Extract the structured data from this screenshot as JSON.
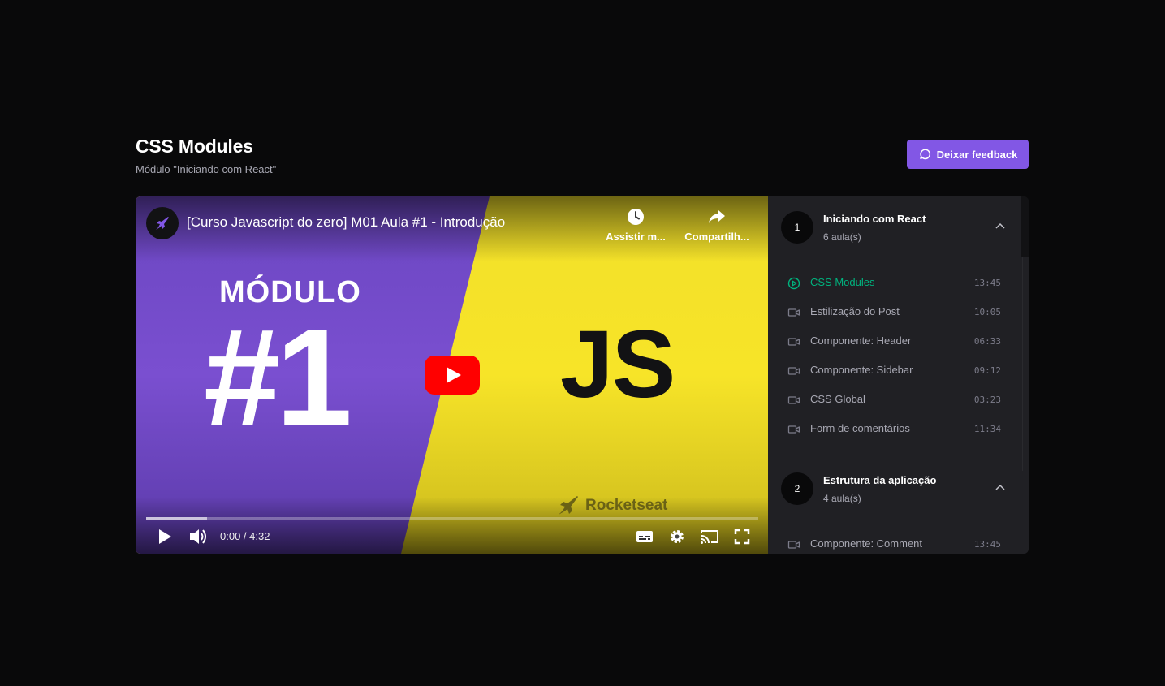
{
  "header": {
    "title": "CSS Modules",
    "subtitle": "Módulo \"Iniciando com React\"",
    "feedback_label": "Deixar feedback"
  },
  "video": {
    "title": "[Curso Javascript do zero] M01 Aula #1 - Introdução",
    "watch_later_label": "Assistir m...",
    "share_label": "Compartilh...",
    "thumbnail_heading": "MÓDULO",
    "thumbnail_number": "#1",
    "thumbnail_logo": "JS",
    "watermark": "Rocketseat",
    "time": "0:00 / 4:32",
    "progress_loaded": 0.1
  },
  "colors": {
    "accent": "#8257e5",
    "active_lesson": "#00b37e",
    "background": "#09090a",
    "panel": "#202024"
  },
  "modules": [
    {
      "number": "1",
      "title": "Iniciando com React",
      "count": "6 aula(s)",
      "lessons": [
        {
          "title": "CSS Modules",
          "duration": "13:45",
          "icon": "play-circle-icon",
          "active": true
        },
        {
          "title": "Estilização do Post",
          "duration": "10:05",
          "icon": "video-camera-icon"
        },
        {
          "title": "Componente: Header",
          "duration": "06:33",
          "icon": "video-camera-icon"
        },
        {
          "title": "Componente: Sidebar",
          "duration": "09:12",
          "icon": "video-camera-icon"
        },
        {
          "title": "CSS Global",
          "duration": "03:23",
          "icon": "video-camera-icon"
        },
        {
          "title": "Form de comentários",
          "duration": "11:34",
          "icon": "video-camera-icon"
        }
      ]
    },
    {
      "number": "2",
      "title": "Estrutura da aplicação",
      "count": "4 aula(s)",
      "lessons": [
        {
          "title": "Componente: Comment",
          "duration": "13:45",
          "icon": "video-camera-icon"
        }
      ]
    }
  ]
}
